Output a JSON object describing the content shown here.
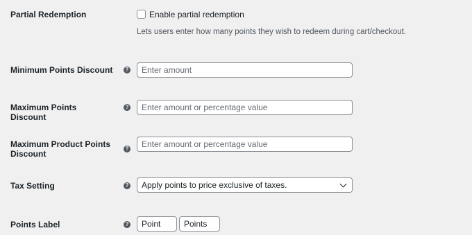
{
  "partial_redemption": {
    "label": "Partial Redemption",
    "checkbox_label": "Enable partial redemption",
    "checked": false,
    "description": "Lets users enter how many points they wish to redeem during cart/checkout."
  },
  "min_points_discount": {
    "label": "Minimum Points Discount",
    "help_icon": "question-circle-icon",
    "value": "",
    "placeholder": "Enter amount"
  },
  "max_points_discount": {
    "label": "Maximum Points Discount",
    "help_icon": "question-circle-icon",
    "value": "",
    "placeholder": "Enter amount or percentage value"
  },
  "max_product_points_discount": {
    "label_line1": "Maximum Product Points",
    "label_line2": "Discount",
    "help_icon": "question-circle-icon",
    "value": "",
    "placeholder": "Enter amount or percentage value"
  },
  "tax_setting": {
    "label": "Tax Setting",
    "help_icon": "question-circle-icon",
    "selected": "Apply points to price exclusive of taxes."
  },
  "points_label": {
    "label": "Points Label",
    "help_icon": "question-circle-icon",
    "singular": "Point",
    "plural": "Points"
  },
  "help_glyph": "?"
}
